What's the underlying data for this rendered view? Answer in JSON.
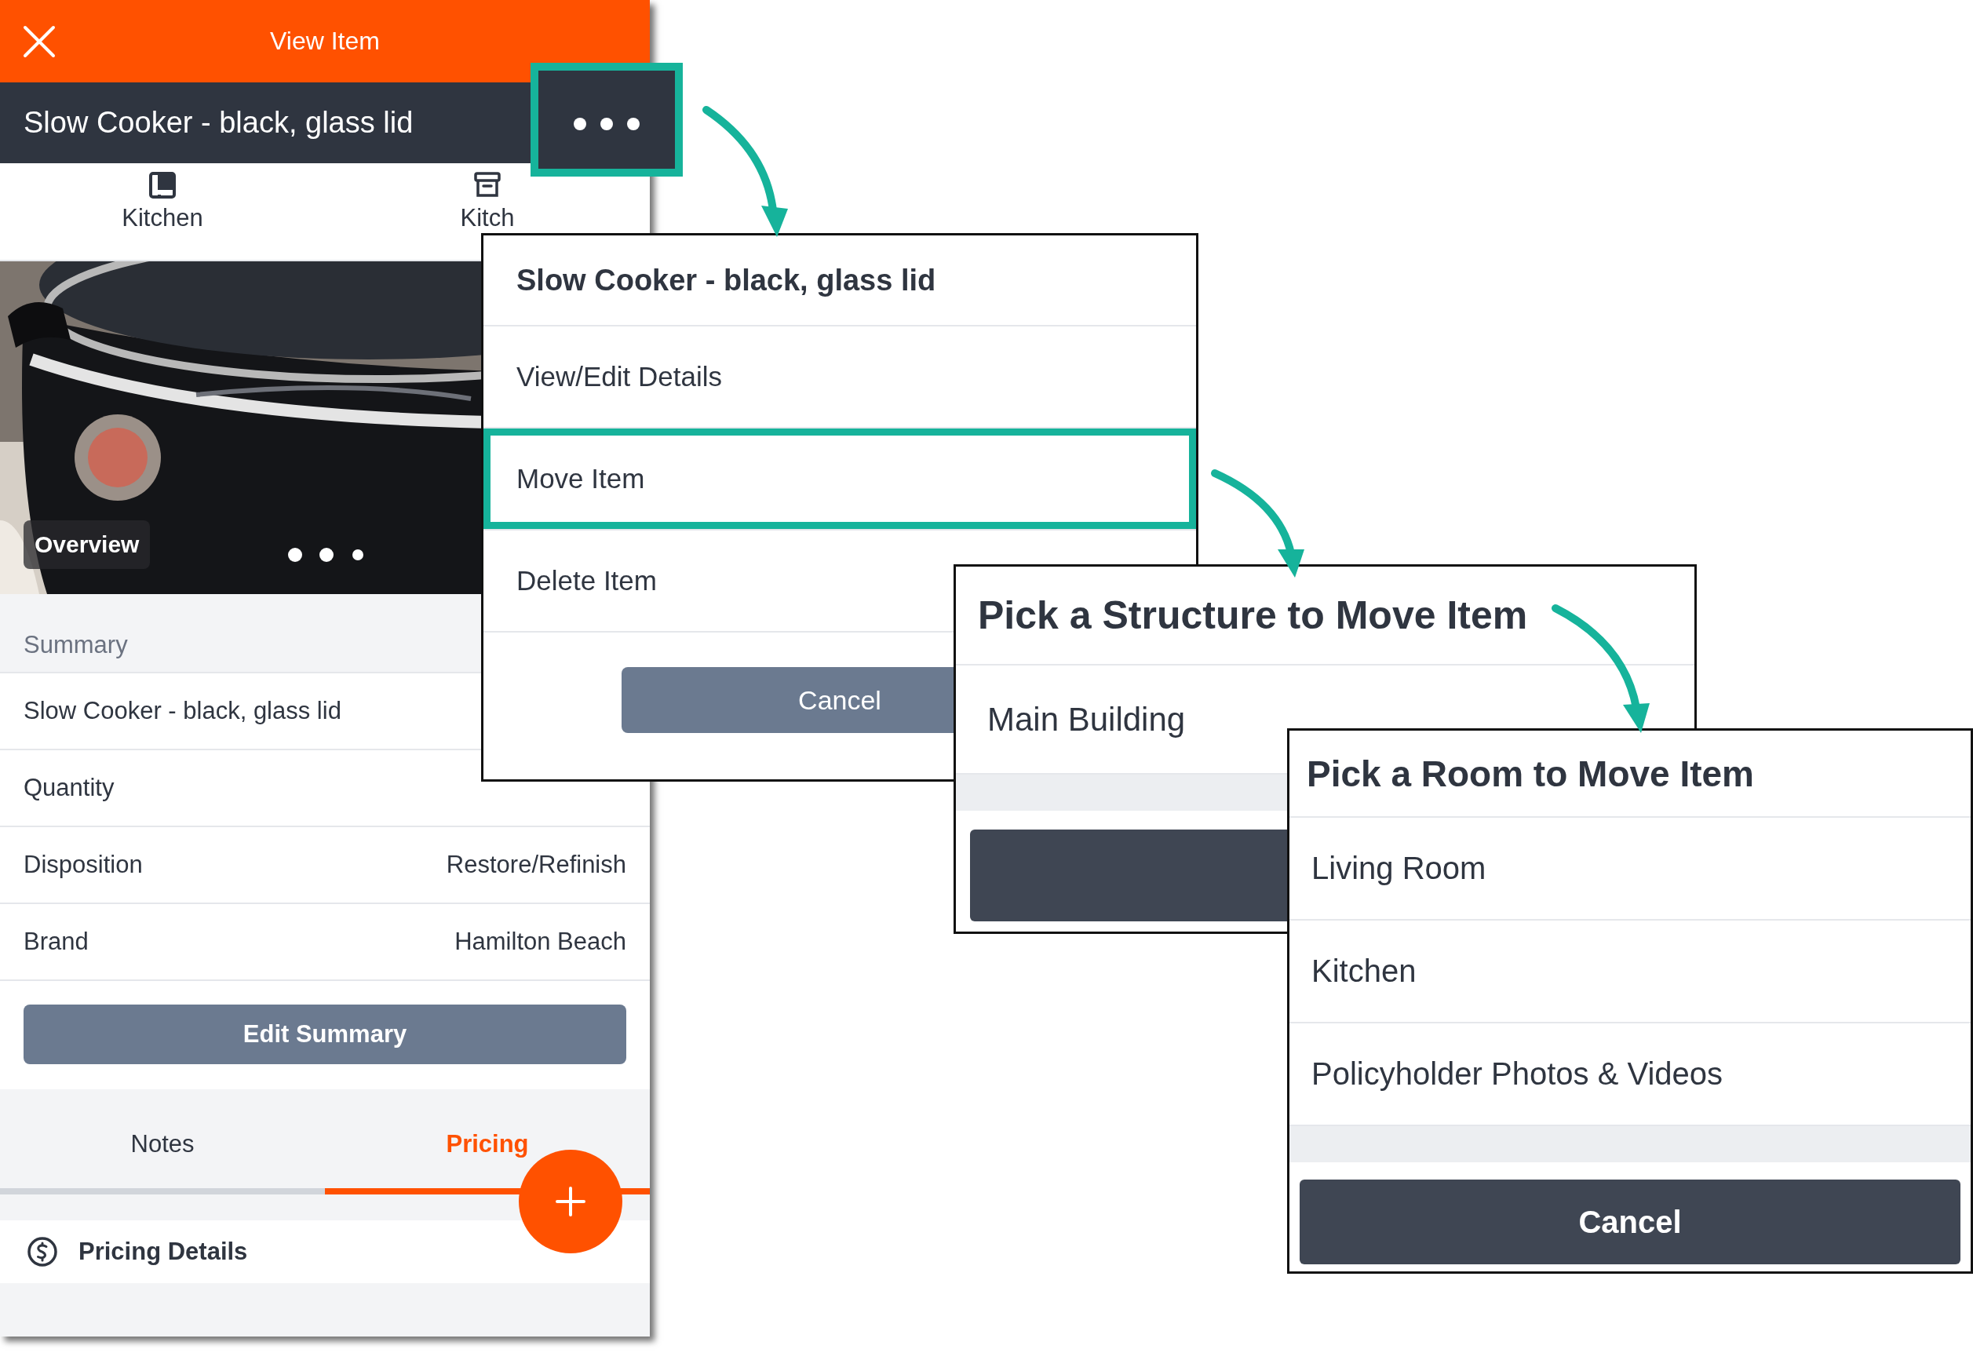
{
  "app_bar": {
    "title": "View Item"
  },
  "item_header": {
    "title": "Slow Cooker - black, glass lid",
    "menu_highlighted": true
  },
  "location_tabs": [
    {
      "label": "Kitchen",
      "kind": "room"
    },
    {
      "label": "Kitch",
      "kind": "box"
    }
  ],
  "photo": {
    "kind": "picture",
    "caption": "Overview"
  },
  "summary": {
    "heading": "Summary",
    "rows": [
      {
        "label": "Slow Cooker - black, glass lid"
      },
      {
        "label": "Quantity"
      },
      {
        "label": "Disposition",
        "value": "Restore/Refinish"
      },
      {
        "label": "Brand",
        "value": "Hamilton Beach"
      }
    ],
    "button": "Edit Summary"
  },
  "section_tabs": [
    {
      "label": "Notes",
      "selected": false
    },
    {
      "label": "Pricing",
      "selected": true
    }
  ],
  "pricing_row": {
    "label": "Pricing Details"
  },
  "menu_dialog": {
    "title": "Slow Cooker - black, glass lid",
    "items": [
      {
        "label": "View/Edit Details",
        "highlighted": false
      },
      {
        "label": "Move Item",
        "highlighted": true
      },
      {
        "label": "Delete Item",
        "highlighted": false
      }
    ],
    "cancel": "Cancel"
  },
  "structure_dialog": {
    "title": "Pick a Structure to Move Item",
    "items": [
      {
        "label": "Main Building"
      }
    ]
  },
  "room_dialog": {
    "title": "Pick a Room to Move Item",
    "items": [
      {
        "label": "Living Room"
      },
      {
        "label": "Kitchen"
      },
      {
        "label": "Policyholder Photos & Videos"
      }
    ],
    "cancel": "Cancel"
  }
}
